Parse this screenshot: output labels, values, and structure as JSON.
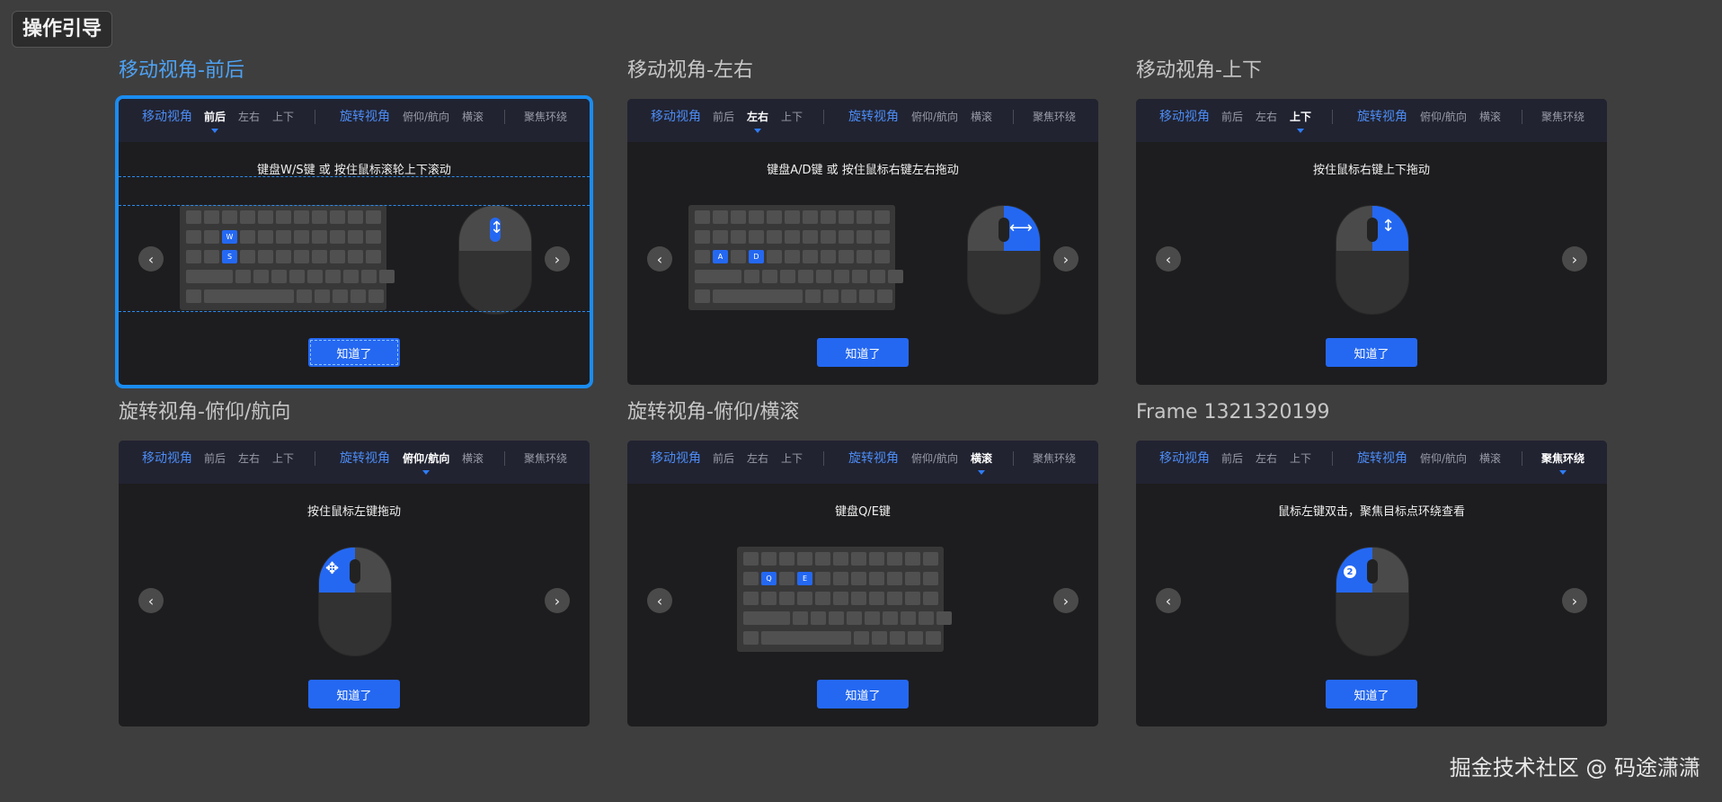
{
  "page_title": "操作引导",
  "watermark": "掘金技术社区 @ 码途潇潇",
  "tab_labels": {
    "move_group": "移动视角",
    "front_back": "前后",
    "left_right": "左右",
    "up_down": "上下",
    "rotate_group": "旋转视角",
    "pitch_yaw": "俯仰/航向",
    "roll": "横滚",
    "orbit": "聚焦环绕"
  },
  "ok_label": "知道了",
  "frames": [
    {
      "title": "移动视角-前后",
      "selected": true,
      "active_tab": "front_back",
      "hint": "键盘W/S键 或 按住鼠标滚轮上下滚动",
      "keys": [
        "W",
        "S"
      ],
      "mouse_glyph": "↕"
    },
    {
      "title": "移动视角-左右",
      "active_tab": "left_right",
      "hint": "键盘A/D键 或 按住鼠标右键左右拖动",
      "keys": [
        "A",
        "D"
      ],
      "mouse_glyph": "⟷"
    },
    {
      "title": "移动视角-上下",
      "active_tab": "up_down",
      "hint": "按住鼠标右键上下拖动",
      "mouse_glyph": "↕"
    },
    {
      "title": "旋转视角-俯仰/航向",
      "active_tab": "pitch_yaw",
      "hint": "按住鼠标左键拖动",
      "mouse_glyph": "✥"
    },
    {
      "title": "旋转视角-俯仰/横滚",
      "active_tab": "roll",
      "hint": "键盘Q/E键",
      "keys": [
        "Q",
        "E"
      ]
    },
    {
      "title": "Frame 1321320199",
      "active_tab": "orbit",
      "hint": "鼠标左键双击，聚焦目标点环绕查看",
      "mouse_badge": "2"
    }
  ],
  "colors": {
    "accent": "#2468f2",
    "tab_group": "#4c8cf5",
    "selection": "#1a8cf0",
    "card_bg": "#1d1d1f",
    "page_bg": "#3e3e3e"
  },
  "icons": {
    "prev": "chevron-left-icon",
    "next": "chevron-right-icon"
  }
}
